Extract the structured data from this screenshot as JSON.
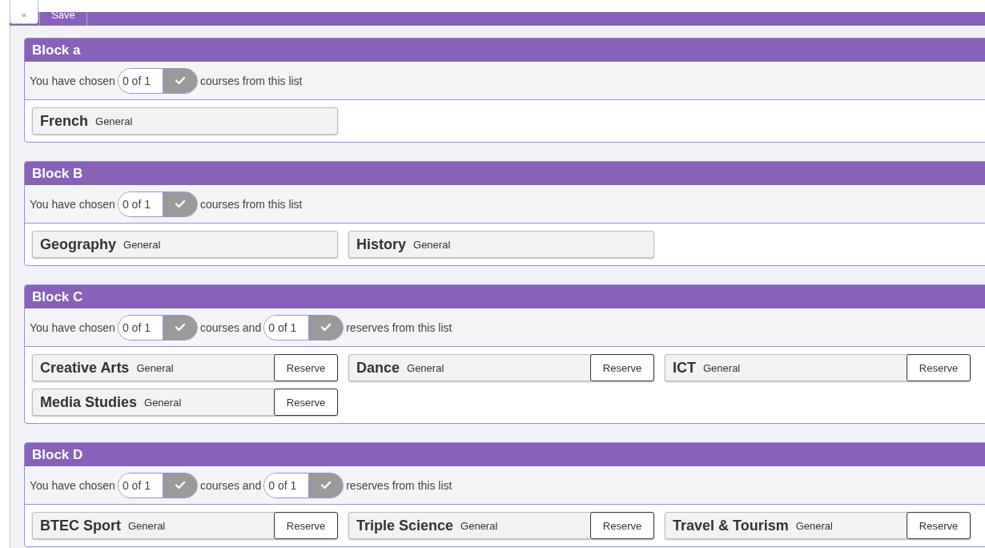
{
  "toolbar": {
    "collapse": "«",
    "save": "Save"
  },
  "blocks": [
    {
      "title": "Block a",
      "summary": [
        {
          "kind": "text",
          "text": "You have chosen"
        },
        {
          "kind": "counter",
          "text": "0 of 1"
        },
        {
          "kind": "text",
          "text": "courses from this list"
        }
      ],
      "courses": [
        {
          "name": "French",
          "type": "General"
        }
      ]
    },
    {
      "title": "Block B",
      "summary": [
        {
          "kind": "text",
          "text": "You have chosen"
        },
        {
          "kind": "counter",
          "text": "0 of 1"
        },
        {
          "kind": "text",
          "text": "courses from this list"
        }
      ],
      "courses": [
        {
          "name": "Geography",
          "type": "General"
        },
        {
          "name": "History",
          "type": "General"
        }
      ]
    },
    {
      "title": "Block C",
      "summary": [
        {
          "kind": "text",
          "text": "You have chosen"
        },
        {
          "kind": "counter",
          "text": "0 of 1"
        },
        {
          "kind": "text",
          "text": "courses and"
        },
        {
          "kind": "counter",
          "text": "0 of 1"
        },
        {
          "kind": "text",
          "text": "reserves from this list"
        }
      ],
      "courses": [
        {
          "name": "Creative Arts",
          "type": "General",
          "reserve": "Reserve"
        },
        {
          "name": "Dance",
          "type": "General",
          "reserve": "Reserve"
        },
        {
          "name": "ICT",
          "type": "General",
          "reserve": "Reserve"
        },
        {
          "name": "Media Studies",
          "type": "General",
          "reserve": "Reserve"
        }
      ]
    },
    {
      "title": "Block D",
      "summary": [
        {
          "kind": "text",
          "text": "You have chosen"
        },
        {
          "kind": "counter",
          "text": "0 of 1"
        },
        {
          "kind": "text",
          "text": "courses and"
        },
        {
          "kind": "counter",
          "text": "0 of 1"
        },
        {
          "kind": "text",
          "text": "reserves from this list"
        }
      ],
      "courses": [
        {
          "name": "BTEC Sport",
          "type": "General",
          "reserve": "Reserve"
        },
        {
          "name": "Triple Science",
          "type": "General",
          "reserve": "Reserve"
        },
        {
          "name": "Travel & Tourism",
          "type": "General",
          "reserve": "Reserve"
        }
      ]
    }
  ]
}
